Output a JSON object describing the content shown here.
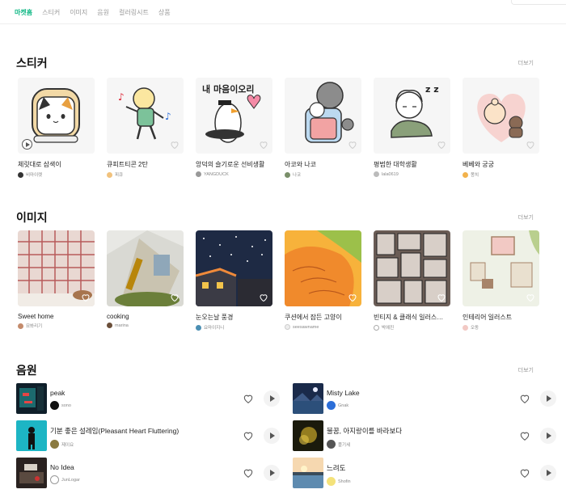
{
  "nav": {
    "tabs": [
      "마켓홈",
      "스티커",
      "이미지",
      "음원",
      "컬러링시트",
      "상품"
    ],
    "active_color": "#12b886"
  },
  "sections": {
    "stickers": {
      "title": "스티커",
      "more": "더보기",
      "items": [
        {
          "title": "체릿대로 삼색이",
          "author": "비마이렛"
        },
        {
          "title": "큐피트티콘 2탄",
          "author": "피큐"
        },
        {
          "title": "앙덕의 슬기로운 선비생활",
          "author": "YANGDUCK"
        },
        {
          "title": "아코와 나코",
          "author": "나코"
        },
        {
          "title": "평범한 대학생활",
          "author": "lala0619"
        },
        {
          "title": "베베와 궁궁",
          "author": "몽치"
        }
      ]
    },
    "images": {
      "title": "이미지",
      "more": "더보기",
      "items": [
        {
          "title": "Sweet home",
          "author": "묘봐리기"
        },
        {
          "title": "cooking",
          "author": "marina"
        },
        {
          "title": "눈오는날 풍경",
          "author": "요마이지니"
        },
        {
          "title": "쿠션에서 잠든 고양이",
          "author": "seesawname"
        },
        {
          "title": "빈티지 & 클래식 일러스…",
          "author": "박예진"
        },
        {
          "title": "인테리어 일러스트",
          "author": "오동"
        }
      ]
    },
    "music": {
      "title": "음원",
      "more": "더보기",
      "left": [
        {
          "title": "peak",
          "artist": "sono"
        },
        {
          "title": "기분 좋은 설레임(Pleasant Heart Fluttering)",
          "artist": "제이요"
        },
        {
          "title": "No Idea",
          "artist": "JunLogar"
        }
      ],
      "right": [
        {
          "title": "Misty Lake",
          "artist": "Gnak"
        },
        {
          "title": "불꿈, 아지랑이를 바라보다",
          "artist": "플기세"
        },
        {
          "title": "느려도",
          "artist": "Shofin"
        }
      ]
    }
  },
  "icons": {
    "heart": "heart-outline-icon",
    "play": "play-icon",
    "sticker_play": "play-circle-icon"
  }
}
